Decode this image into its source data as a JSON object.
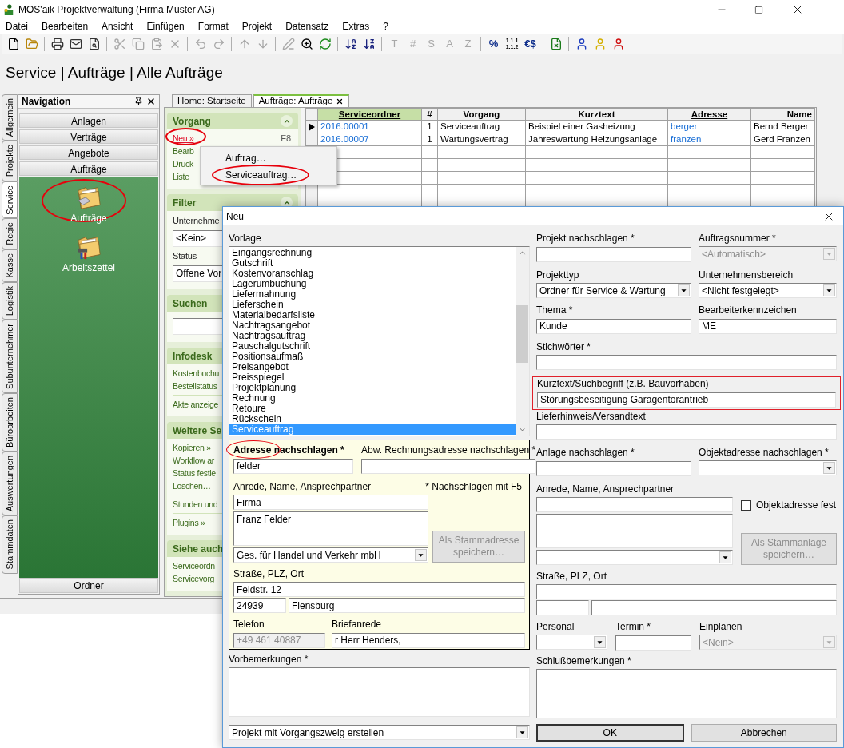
{
  "window": {
    "title": "MOS'aik Projektverwaltung (Firma Muster AG)"
  },
  "menu": [
    "Datei",
    "Bearbeiten",
    "Ansicht",
    "Einfügen",
    "Format",
    "Projekt",
    "Datensatz",
    "Extras",
    "?"
  ],
  "toolbar": [
    [
      {
        "kind": "icon",
        "disabled": false
      },
      {
        "kind": "icon",
        "disabled": false
      }
    ],
    [
      {
        "kind": "icon",
        "disabled": false
      },
      {
        "kind": "icon",
        "disabled": false
      },
      {
        "kind": "icon",
        "disabled": false
      }
    ],
    [
      {
        "kind": "icon",
        "disabled": true
      },
      {
        "kind": "icon",
        "disabled": true
      },
      {
        "kind": "icon",
        "disabled": true
      },
      {
        "kind": "icon",
        "disabled": true
      }
    ],
    [
      {
        "kind": "icon",
        "disabled": true
      },
      {
        "kind": "icon",
        "disabled": true
      }
    ],
    [
      {
        "kind": "icon",
        "disabled": true
      },
      {
        "kind": "icon",
        "disabled": true
      }
    ],
    [
      {
        "kind": "icon",
        "disabled": true
      },
      {
        "kind": "icon",
        "disabled": false
      },
      {
        "kind": "icon",
        "disabled": false
      }
    ],
    [
      {
        "kind": "icon",
        "disabled": false
      },
      {
        "kind": "icon",
        "disabled": false
      }
    ],
    [
      {
        "kind": "text",
        "label": "T",
        "disabled": true
      },
      {
        "kind": "text",
        "label": "#",
        "disabled": true
      },
      {
        "kind": "text",
        "label": "S",
        "disabled": true
      },
      {
        "kind": "text",
        "label": "A",
        "disabled": true
      },
      {
        "kind": "text",
        "label": "Z",
        "disabled": true
      }
    ],
    [
      {
        "kind": "text",
        "label": "%",
        "disabled": false
      },
      {
        "kind": "lines",
        "lines": [
          "1.1.1",
          "1.1.2"
        ],
        "disabled": false
      },
      {
        "kind": "text",
        "label": "€$",
        "disabled": false
      }
    ],
    [
      {
        "kind": "icon",
        "disabled": false
      }
    ],
    [
      {
        "kind": "icon",
        "disabled": false
      },
      {
        "kind": "icon",
        "disabled": false
      },
      {
        "kind": "icon",
        "disabled": false
      }
    ]
  ],
  "breadcrumb": "Service | Aufträge | Alle Aufträge",
  "side_tabs": [
    {
      "label": "Allgemein",
      "selected": false
    },
    {
      "label": "Projekte",
      "selected": false
    },
    {
      "label": "Service",
      "selected": true
    },
    {
      "label": "Regie",
      "selected": false
    },
    {
      "label": "Kasse",
      "selected": false
    },
    {
      "label": "Logistik",
      "selected": false
    },
    {
      "label": "Subunternehmer",
      "selected": false
    },
    {
      "label": "Büroarbeiten",
      "selected": false
    },
    {
      "label": "Auswertungen",
      "selected": false
    },
    {
      "label": "Stammdaten",
      "selected": false
    }
  ],
  "navigation": {
    "title": "Navigation",
    "buttons": [
      "Anlagen",
      "Verträge",
      "Angebote",
      "Aufträge"
    ],
    "items": [
      {
        "label": "Aufträge",
        "circled": true
      },
      {
        "label": "Arbeitszettel",
        "circled": false
      }
    ],
    "footer_button": "Ordner"
  },
  "doc_tabs": [
    {
      "label": "Home: Startseite",
      "selected": false
    },
    {
      "label": "Aufträge: Aufträge",
      "selected": true
    }
  ],
  "task_pane": [
    {
      "title": "Vorgang",
      "collapse_button": true,
      "groups": [
        [
          {
            "kind": "link",
            "label": "Neu »",
            "shortcut": "F8",
            "open": true,
            "circled": true
          },
          {
            "kind": "link",
            "label": "Bearb",
            "open": false,
            "circled": false
          },
          {
            "kind": "link",
            "label": "Druck",
            "open": false,
            "circled": false
          },
          {
            "kind": "link",
            "label": "Liste",
            "open": false,
            "circled": false
          }
        ]
      ]
    },
    {
      "title": "Filter",
      "collapse_button": true,
      "groups": [
        [
          {
            "kind": "label",
            "label": "Unternehme"
          },
          {
            "kind": "field",
            "value": "<Kein>"
          },
          {
            "kind": "label",
            "label": "Status"
          },
          {
            "kind": "field",
            "value": "Offene Vor"
          }
        ]
      ]
    },
    {
      "title": "Suchen",
      "groups": [
        [
          {
            "kind": "field"
          }
        ]
      ]
    },
    {
      "title": "Infodesk",
      "groups": [
        [
          {
            "kind": "link",
            "label": "Kostenbuchu"
          },
          {
            "kind": "link",
            "label": "Bestellstatus"
          }
        ],
        [
          {
            "kind": "link",
            "label": "Akte anzeige"
          }
        ]
      ]
    },
    {
      "title": "Weitere Se",
      "groups": [
        [
          {
            "kind": "link",
            "label": "Kopieren »"
          },
          {
            "kind": "link",
            "label": "Workflow ar"
          },
          {
            "kind": "link",
            "label": "Status festle"
          },
          {
            "kind": "link",
            "label": "Löschen…"
          }
        ],
        [
          {
            "kind": "link",
            "label": "Stunden und"
          }
        ],
        [
          {
            "kind": "link",
            "label": "Plugins »"
          }
        ]
      ]
    },
    {
      "title": "Siehe auch",
      "groups": [
        [
          {
            "kind": "link",
            "label": "Serviceordn"
          },
          {
            "kind": "link",
            "label": "Servicevorg"
          }
        ]
      ]
    }
  ],
  "context_menu": [
    {
      "label": "Auftrag…",
      "circled": false
    },
    {
      "label": "Serviceauftrag…",
      "circled": true
    }
  ],
  "table": {
    "columns": [
      {
        "label": "Serviceordner",
        "sorted": true,
        "link": true
      },
      {
        "label": "#",
        "sorted": false,
        "link": false
      },
      {
        "label": "Vorgang",
        "sorted": false,
        "link": false
      },
      {
        "label": "Kurztext",
        "sorted": false,
        "link": false
      },
      {
        "label": "Adresse",
        "sorted": false,
        "link": true
      },
      {
        "label": "Name",
        "sorted": false,
        "link": false
      }
    ],
    "rows": [
      {
        "selected": true,
        "cells": [
          "2016.00001",
          "1",
          "Serviceauftrag",
          "Beispiel einer Gasheizung",
          "berger",
          "Bernd Berger"
        ]
      },
      {
        "selected": false,
        "cells": [
          "2016.00007",
          "1",
          "Wartungsvertrag",
          "Jahreswartung Heizungsanlage",
          "franzen",
          "Gerd Franzen"
        ]
      }
    ]
  },
  "dialog": {
    "title": "Neu",
    "template": {
      "label": "Vorlage",
      "items": [
        {
          "label": "Eingangsrechnung",
          "selected": false
        },
        {
          "label": "Gutschrift",
          "selected": false
        },
        {
          "label": "Kostenvoranschlag",
          "selected": false
        },
        {
          "label": "Lagerumbuchung",
          "selected": false
        },
        {
          "label": "Liefermahnung",
          "selected": false
        },
        {
          "label": "Lieferschein",
          "selected": false
        },
        {
          "label": "Materialbedarfsliste",
          "selected": false
        },
        {
          "label": "Nachtragsangebot",
          "selected": false
        },
        {
          "label": "Nachtragsauftrag",
          "selected": false
        },
        {
          "label": "Pauschalgutschrift",
          "selected": false
        },
        {
          "label": "Positionsaufmaß",
          "selected": false
        },
        {
          "label": "Preisangebot",
          "selected": false
        },
        {
          "label": "Preisspiegel",
          "selected": false
        },
        {
          "label": "Projektplanung",
          "selected": false
        },
        {
          "label": "Rechnung",
          "selected": false
        },
        {
          "label": "Retoure",
          "selected": false
        },
        {
          "label": "Rückschein",
          "selected": false
        },
        {
          "label": "Serviceauftrag",
          "selected": true
        }
      ]
    },
    "address": {
      "lookup": {
        "label": "Adresse nachschlagen *",
        "value": "felder",
        "circled": true
      },
      "billing_lookup": {
        "label": "Abw. Rechnungsadresse nachschlagen *"
      },
      "contact_label": "Anrede, Name, Ansprechpartner",
      "hint": "* Nachschlagen mit F5",
      "salutation": "Firma",
      "name": "Franz Felder",
      "company": "Ges. für Handel und Verkehr mbH",
      "save_button": {
        "label": "Als Stammadresse speichern…",
        "disabled": true
      },
      "street_label": "Straße, PLZ, Ort",
      "street": "Feldstr. 12",
      "zip": "24939",
      "city": "Flensburg",
      "phone": {
        "label": "Telefon",
        "value": "+49 461 40887",
        "disabled": true
      },
      "letter_salutation": {
        "label": "Briefanrede",
        "value": "r Herr Henders,"
      }
    },
    "pre_remarks": {
      "label": "Vorbemerkungen *"
    },
    "create_mode": "Projekt mit Vorgangszweig erstellen",
    "project_lookup": {
      "label": "Projekt nachschlagen *"
    },
    "order_number": {
      "label": "Auftragsnummer *",
      "value": "<Automatisch>",
      "disabled": true
    },
    "project_type": {
      "label": "Projekttyp",
      "value": "Ordner für Service & Wartung"
    },
    "business_unit": {
      "label": "Unternehmensbereich",
      "value": "<Nicht festgelegt>"
    },
    "topic": {
      "label": "Thema *",
      "value": "Kunde"
    },
    "editor_code": {
      "label": "Bearbeiterkennzeichen",
      "value": "ME"
    },
    "keywords": {
      "label": "Stichwörter *"
    },
    "short_text": {
      "label": "Kurztext/Suchbegriff (z.B. Bauvorhaben)",
      "value": "Störungsbeseitigung Garagentorantrieb",
      "highlighted": true
    },
    "delivery_note": {
      "label": "Lieferhinweis/Versandtext"
    },
    "facility_lookup": {
      "label": "Anlage nachschlagen *"
    },
    "object_address_lookup": {
      "label": "Objektadresse nachschlagen *"
    },
    "object_contact_label": "Anrede, Name, Ansprechpartner",
    "object_address_fixed": {
      "label": "Objektadresse fest",
      "checked": false
    },
    "facility_save_button": {
      "label": "Als Stammanlage speichern…",
      "disabled": true
    },
    "object_street_label": "Straße, PLZ, Ort",
    "staff": {
      "label": "Personal"
    },
    "date": {
      "label": "Termin *"
    },
    "schedule": {
      "label": "Einplanen",
      "value": "<Nein>",
      "disabled": true
    },
    "final_remarks": {
      "label": "Schlußbemerkungen *"
    },
    "buttons": [
      {
        "label": "OK",
        "default": true
      },
      {
        "label": "Abbrechen",
        "default": false
      }
    ]
  }
}
